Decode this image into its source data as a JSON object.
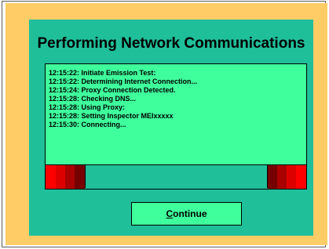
{
  "dialog": {
    "title": "Performing Network Communications",
    "log_lines": [
      "12:15:22: Initiate Emission Test:",
      "12:15:22: Determining Internet Connection...",
      "12:15:24: Proxy Connection Detected.",
      "12:15:28: Checking DNS...",
      "12:15:28: Using Proxy:",
      "12:15:28: Setting Inspector MEIxxxxx",
      "12:15:30: Connecting..."
    ],
    "continue_button": {
      "accel_char": "C",
      "rest_label": "ontinue"
    },
    "colors": {
      "outer_background": "#ffcc66",
      "panel_background": "#1fbf9a",
      "log_background": "#3fff9c",
      "progress_reds": [
        "#ff0000",
        "#dd0000",
        "#aa0000",
        "#770000"
      ]
    }
  }
}
